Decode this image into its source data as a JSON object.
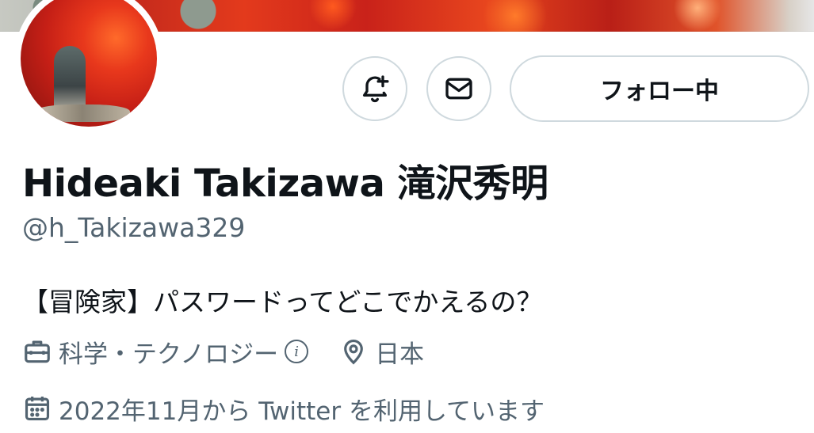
{
  "profile": {
    "display_name": "Hideaki Takizawa 滝沢秀明",
    "handle": "@h_Takizawa329",
    "bio": "【冒険家】パスワードってどこでかえるの？",
    "category": "科学・テクノロジー",
    "location": "日本",
    "joined": "2022年11月から Twitter を利用しています"
  },
  "actions": {
    "follow_label": "フォロー中"
  },
  "icons": {
    "notify": "bell-plus-icon",
    "message": "envelope-icon",
    "category": "briefcase-icon",
    "info": "info-icon",
    "location": "location-pin-icon",
    "joined": "calendar-icon"
  },
  "colors": {
    "text_primary": "#0f1419",
    "text_secondary": "#536471",
    "button_border": "#cfd9de"
  }
}
